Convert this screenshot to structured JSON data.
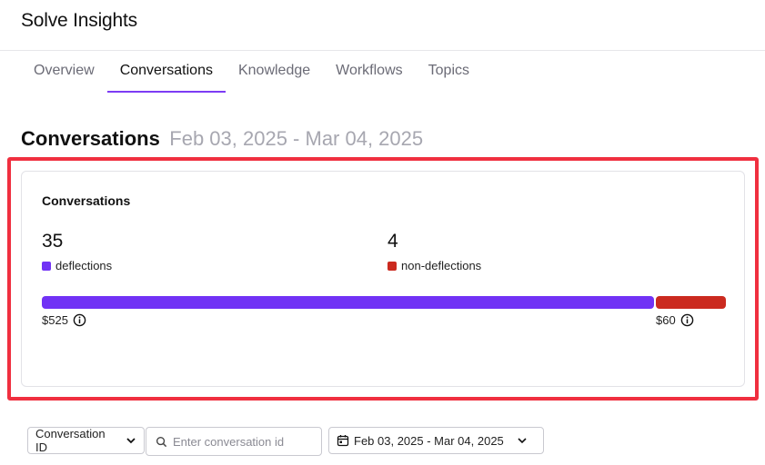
{
  "app": {
    "title": "Solve Insights"
  },
  "tabs": [
    {
      "label": "Overview",
      "active": false
    },
    {
      "label": "Conversations",
      "active": true
    },
    {
      "label": "Knowledge",
      "active": false
    },
    {
      "label": "Workflows",
      "active": false
    },
    {
      "label": "Topics",
      "active": false
    }
  ],
  "heading": {
    "title": "Conversations",
    "date_range": "Feb 03, 2025 - Mar 04, 2025"
  },
  "card": {
    "title": "Conversations",
    "deflections": {
      "value": "35",
      "label": "deflections",
      "cost": "$525",
      "color": "#7132f5"
    },
    "non_deflections": {
      "value": "4",
      "label": "non-deflections",
      "cost": "$60",
      "color": "#cb2a1f"
    },
    "highlight_color": "#f02f3f"
  },
  "chart_data": {
    "type": "bar",
    "categories": [
      "deflections",
      "non-deflections"
    ],
    "values": [
      35,
      4
    ],
    "costs": [
      "$525",
      "$60"
    ],
    "colors": [
      "#7132f5",
      "#cb2a1f"
    ],
    "stacked": true,
    "title": "Conversations"
  },
  "filters": {
    "field_select": {
      "value": "Conversation ID",
      "icon": "chevron-down-icon"
    },
    "search": {
      "placeholder": "Enter conversation id",
      "value": "",
      "icon": "search-icon"
    },
    "date_select": {
      "value": "Feb 03, 2025 - Mar 04, 2025",
      "icon": "calendar-icon"
    }
  },
  "colors": {
    "accent": "#7d3cf4",
    "muted_text": "#a7a7b0"
  }
}
